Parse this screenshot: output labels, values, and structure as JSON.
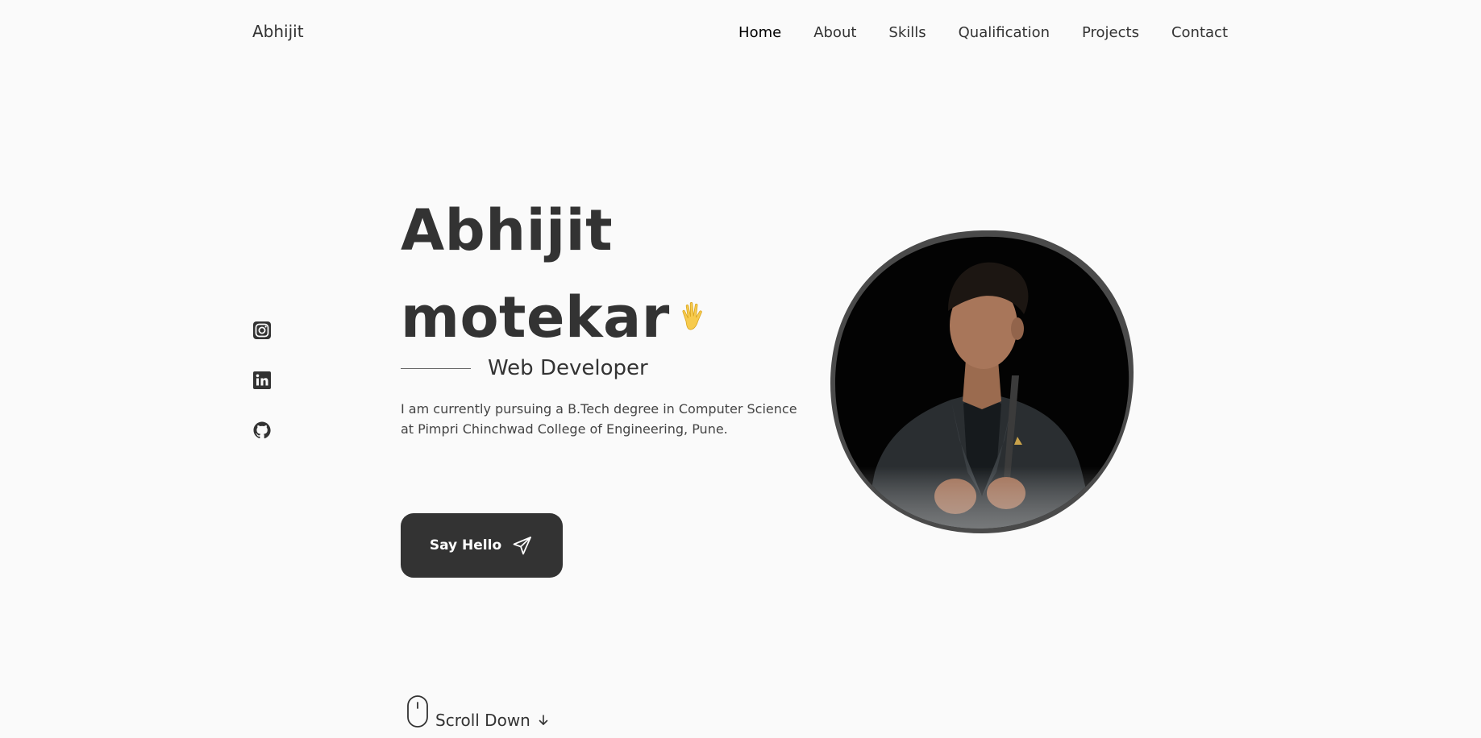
{
  "header": {
    "logo": "Abhijit",
    "nav": [
      {
        "label": "Home",
        "active": true
      },
      {
        "label": "About",
        "active": false
      },
      {
        "label": "Skills",
        "active": false
      },
      {
        "label": "Qualification",
        "active": false
      },
      {
        "label": "Projects",
        "active": false
      },
      {
        "label": "Contact",
        "active": false
      }
    ]
  },
  "social": [
    {
      "icon": "instagram-icon"
    },
    {
      "icon": "linkedin-icon"
    },
    {
      "icon": "github-icon"
    }
  ],
  "hero": {
    "name_line1": "Abhijit",
    "name_line2": "motekar",
    "emoji": "waving-hand-icon",
    "subtitle": "Web Developer",
    "description": "I am currently pursuing a B.Tech degree in Computer Science at Pimpri Chinchwad College of Engineering, Pune.",
    "button_label": "Say Hello",
    "button_icon": "send-icon"
  },
  "profile": {
    "image": "profile-photo"
  },
  "scroll": {
    "label": "Scroll Down",
    "icon": "mouse-icon",
    "arrow_icon": "arrow-down-icon"
  },
  "colors": {
    "background": "#fafafa",
    "text": "#333333",
    "button": "#333333",
    "blob_border": "#4a4a4a",
    "emoji": "#f2c94c"
  }
}
